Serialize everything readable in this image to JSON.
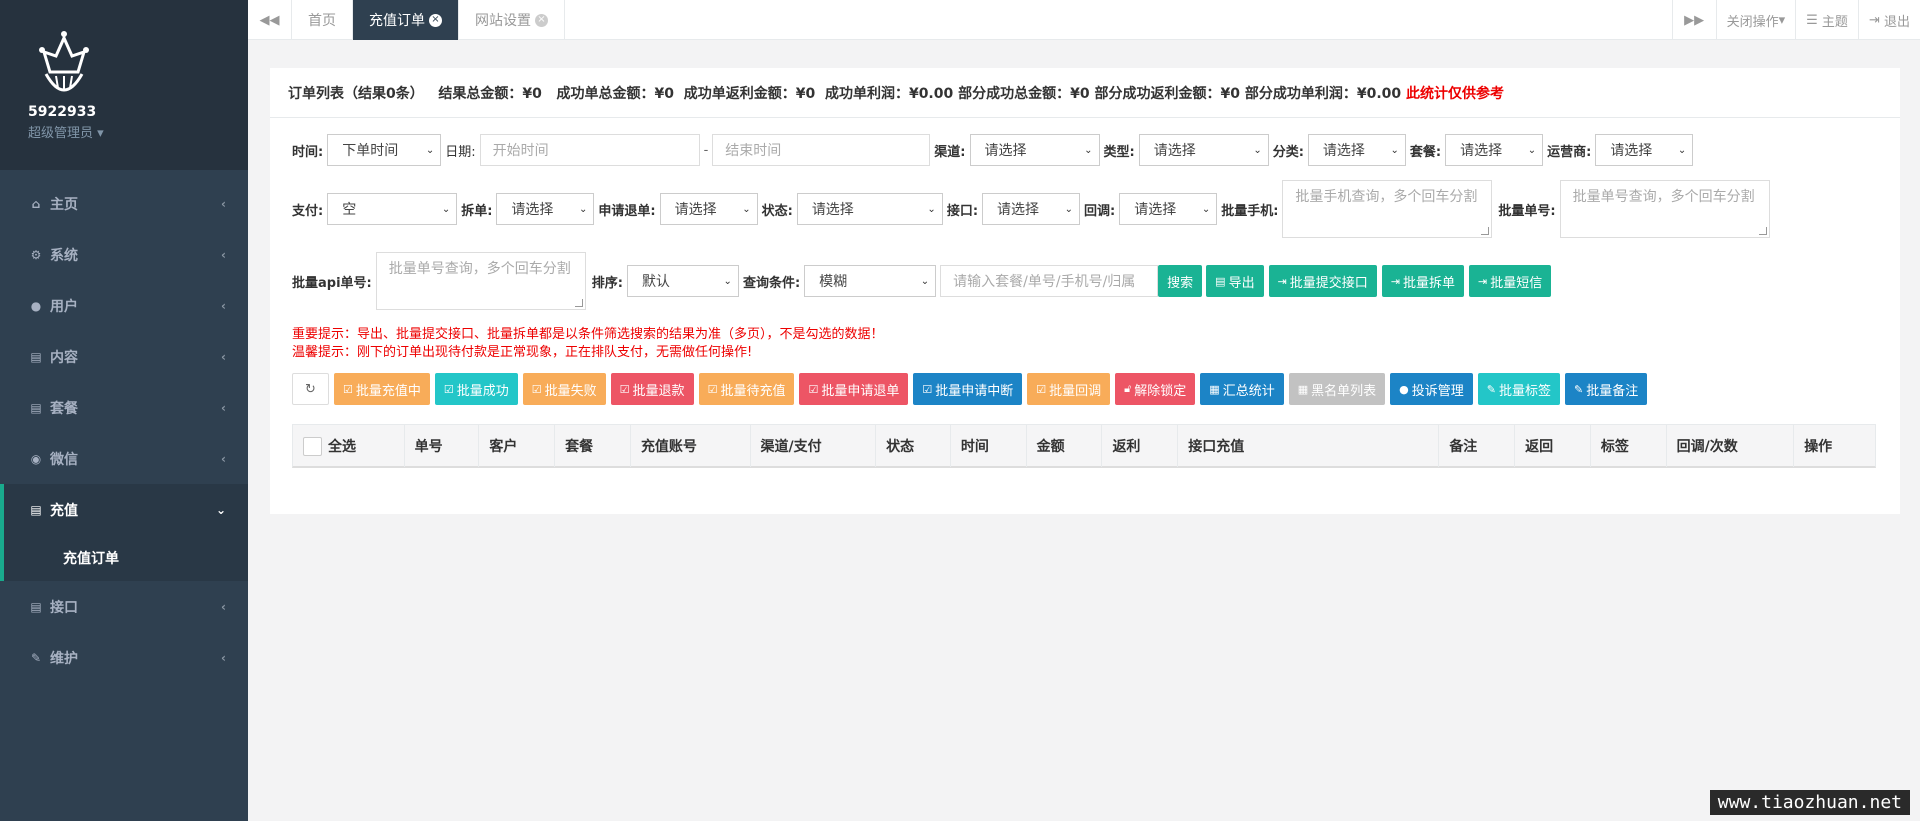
{
  "sidebar": {
    "user_id": "5922933",
    "role": "超级管理员",
    "items": [
      {
        "label": "主页",
        "icon": "home-icon"
      },
      {
        "label": "系统",
        "icon": "cogs-icon"
      },
      {
        "label": "用户",
        "icon": "users-icon"
      },
      {
        "label": "内容",
        "icon": "file-icon"
      },
      {
        "label": "套餐",
        "icon": "file-text-icon"
      },
      {
        "label": "微信",
        "icon": "wechat-icon"
      },
      {
        "label": "充值",
        "icon": "file-icon",
        "sub": "充值订单"
      },
      {
        "label": "接口",
        "icon": "file-icon"
      },
      {
        "label": "维护",
        "icon": "wrench-icon"
      }
    ]
  },
  "topbar": {
    "tabs": [
      "首页",
      "充值订单",
      "网站设置"
    ],
    "close_ops": "关闭操作",
    "theme": "主题",
    "logout": "退出"
  },
  "summary": {
    "list": "订单列表（结果0条）",
    "total": "结果总金额：¥0",
    "success_total": "成功单总金额：¥0",
    "success_rebate": "成功单返利金额：¥0",
    "success_profit": "成功单利润：¥0.00",
    "partial_total": "部分成功总金额：¥0",
    "partial_rebate": "部分成功返利金额：¥0",
    "partial_profit": "部分成功单利润：¥0.00",
    "note": "此统计仅供参考"
  },
  "filters": {
    "time_label": "时间:",
    "time_value": "下单时间",
    "date_label": "日期:",
    "start_ph": "开始时间",
    "dash": "-",
    "end_ph": "结束时间",
    "channel_label": "渠道:",
    "type_label": "类型:",
    "category_label": "分类:",
    "package_label": "套餐:",
    "operator_label": "运营商:",
    "pay_label": "支付:",
    "pay_value": "空",
    "split_label": "拆单:",
    "refund_label": "申请退单:",
    "status_label": "状态:",
    "api_label": "接口:",
    "callback_label": "回调:",
    "batch_phone_label": "批量手机:",
    "batch_phone_ph": "批量手机查询，多个回车分割",
    "batch_order_label": "批量单号:",
    "batch_order_ph": "批量单号查询，多个回车分割",
    "batch_api_label": "批量api单号:",
    "batch_api_ph": "批量单号查询，多个回车分割",
    "sort_label": "排序:",
    "sort_value": "默认",
    "cond_label": "查询条件:",
    "cond_value": "模糊",
    "search_ph": "请输入套餐/单号/手机号/归属",
    "placeholder": "请选择"
  },
  "actions": {
    "search": "搜索",
    "export": "导出",
    "batch_submit": "批量提交接口",
    "batch_split": "批量拆单",
    "batch_sms": "批量短信"
  },
  "notes": {
    "important": "重要提示：导出、批量提交接口、批量拆单都是以条件筛选搜索的结果为准（多页），不是勾选的数据！",
    "warm": "温馨提示：刚下的订单出现待付款是正常现象，正在排队支付，无需做任何操作!"
  },
  "batch_buttons": [
    {
      "label": "批量充值中",
      "color": "#f8ac59"
    },
    {
      "label": "批量成功",
      "color": "#23c6c8"
    },
    {
      "label": "批量失败",
      "color": "#f8ac59"
    },
    {
      "label": "批量退款",
      "color": "#ed5565"
    },
    {
      "label": "批量待充值",
      "color": "#f8ac59"
    },
    {
      "label": "批量申请退单",
      "color": "#ed5565"
    },
    {
      "label": "批量申请中断",
      "color": "#1c84c6"
    },
    {
      "label": "批量回调",
      "color": "#f8ac59"
    },
    {
      "label": "解除锁定",
      "color": "#ed5565"
    },
    {
      "label": "汇总统计",
      "color": "#1c84c6"
    },
    {
      "label": "黑名单列表",
      "color": "#c2c2c2"
    },
    {
      "label": "投诉管理",
      "color": "#1c84c6"
    },
    {
      "label": "批量标签",
      "color": "#23c6c8"
    },
    {
      "label": "批量备注",
      "color": "#1c84c6"
    }
  ],
  "table": {
    "headers": [
      "全选",
      "单号",
      "客户",
      "套餐",
      "充值账号",
      "渠道/支付",
      "状态",
      "时间",
      "金额",
      "返利",
      "接口充值",
      "备注",
      "返回",
      "标签",
      "回调/次数",
      "操作"
    ]
  },
  "watermark": "www.tiaozhuan.net"
}
